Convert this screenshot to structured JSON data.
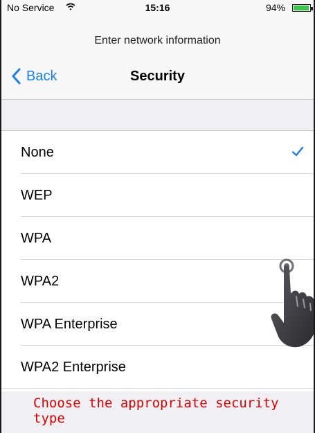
{
  "status_bar": {
    "carrier": "No Service",
    "wifi_icon": "wifi-icon",
    "time": "15:16",
    "battery_percent": "94%",
    "battery_level": 0.94,
    "battery_color": "#37c84a"
  },
  "header": {
    "prompt": "Enter network information",
    "back_label": "Back",
    "title": "Security"
  },
  "options": [
    {
      "label": "None",
      "selected": true
    },
    {
      "label": "WEP",
      "selected": false
    },
    {
      "label": "WPA",
      "selected": false
    },
    {
      "label": "WPA2",
      "selected": false
    },
    {
      "label": "WPA Enterprise",
      "selected": false
    },
    {
      "label": "WPA2 Enterprise",
      "selected": false
    }
  ],
  "footer_note": "Choose the appropriate security type",
  "colors": {
    "accent": "#1a7fe8",
    "note": "#e00000"
  }
}
